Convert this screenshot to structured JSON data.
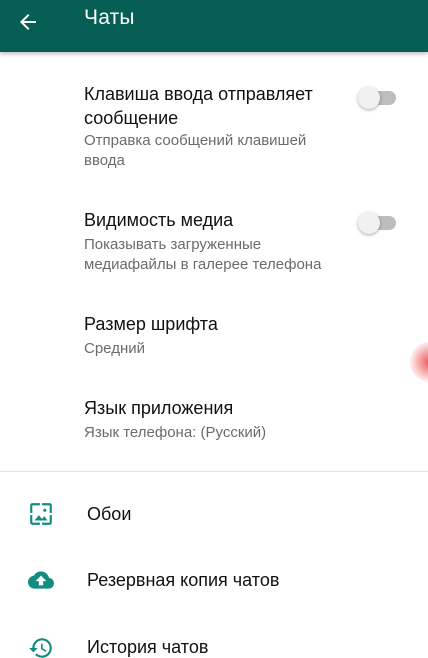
{
  "appbar": {
    "title": "Чаты",
    "back_icon": "arrow-back-icon"
  },
  "settings": [
    {
      "title": "Клавиша ввода отправляет сообщение",
      "summary": "Отправка сообщений клавишей ввода",
      "toggle": false
    },
    {
      "title": "Видимость медиа",
      "summary": "Показывать загруженные медиафайлы в галерее телефона",
      "toggle": false
    },
    {
      "title": "Размер шрифта",
      "summary": "Средний"
    },
    {
      "title": "Язык приложения",
      "summary": "Язык телефона: (Русский)"
    }
  ],
  "items": [
    {
      "label": "Обои",
      "icon": "wallpaper-icon"
    },
    {
      "label": "Резервная копия чатов",
      "icon": "cloud-upload-icon"
    },
    {
      "label": "История чатов",
      "icon": "history-icon"
    }
  ],
  "colors": {
    "appbar": "#075e54",
    "icon": "#128c7e",
    "title_text": "#111111",
    "summary_text": "#6b6b6b"
  }
}
